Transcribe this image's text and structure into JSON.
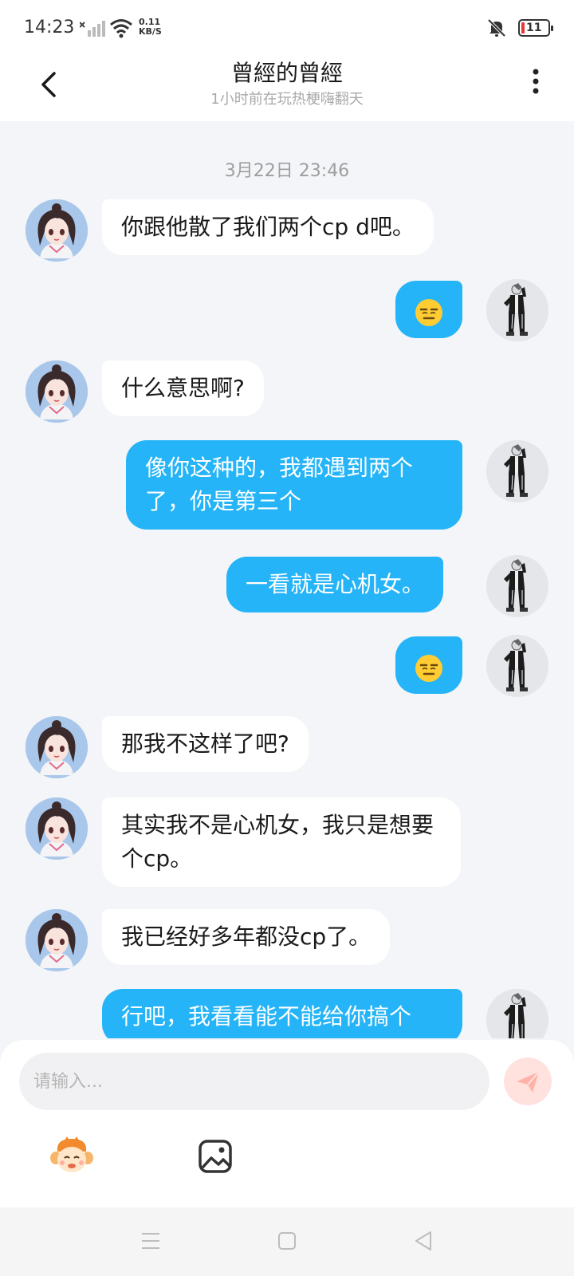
{
  "status_bar": {
    "time": "14:23",
    "speed_value": "0.11",
    "speed_unit": "KB/S",
    "battery": "11"
  },
  "header": {
    "title": "曾經的曾經",
    "subtitle": "1小时前在玩热梗嗨翻天",
    "back_icon": "chevron-left-icon",
    "more_icon": "more-vertical-icon"
  },
  "chat": {
    "timestamp": "3月22日 23:46",
    "messages": [
      {
        "side": "left",
        "text": "你跟他散了我们两个cp d吧。"
      },
      {
        "side": "right",
        "type": "emoji",
        "emoji": "expressionless-face"
      },
      {
        "side": "left",
        "text": "什么意思啊?"
      },
      {
        "side": "right",
        "text": "像你这种的，我都遇到两个了，你是第三个"
      },
      {
        "side": "right",
        "text": "一看就是心机女。"
      },
      {
        "side": "right",
        "type": "emoji",
        "emoji": "expressionless-face"
      },
      {
        "side": "left",
        "text": "那我不这样了吧?"
      },
      {
        "side": "left",
        "text": "其实我不是心机女，我只是想要个cp。"
      },
      {
        "side": "left",
        "text": "我已经好多年都没cp了。"
      },
      {
        "side": "right",
        "text": "行吧，我看看能不能给你搞个"
      }
    ]
  },
  "input": {
    "placeholder": "请输入...",
    "send_icon": "send-icon",
    "sticker_icon": "monkey-sticker-icon",
    "image_icon": "image-icon"
  },
  "colors": {
    "my_bubble": "#25b4f7",
    "their_bubble": "#ffffff",
    "background": "#f3f5f8",
    "send_button": "#ffe2de",
    "send_arrow": "#ffb3a8"
  }
}
